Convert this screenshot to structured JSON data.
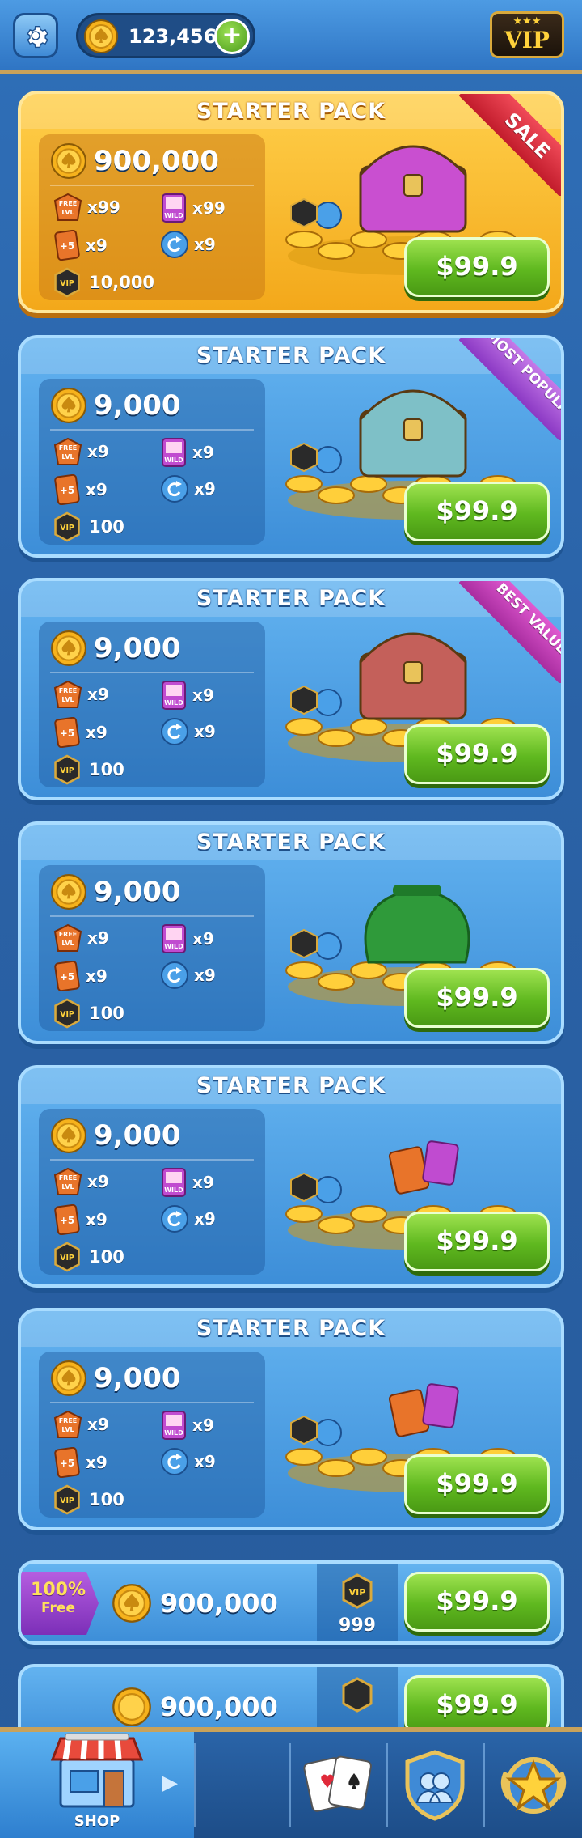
{
  "header": {
    "coin_balance": "123,456",
    "vip_label": "VIP"
  },
  "packs": [
    {
      "title": "STARTER PACK",
      "amount": "900,000",
      "free_lvl": "x99",
      "wild": "x99",
      "plus5": "x9",
      "undo": "x9",
      "vip_points": "10,000",
      "price": "$99.9",
      "ribbon": "SALE"
    },
    {
      "title": "STARTER PACK",
      "amount": "9,000",
      "free_lvl": "x9",
      "wild": "x9",
      "plus5": "x9",
      "undo": "x9",
      "vip_points": "100",
      "price": "$99.9",
      "ribbon": "MOST POPULAR"
    },
    {
      "title": "STARTER PACK",
      "amount": "9,000",
      "free_lvl": "x9",
      "wild": "x9",
      "plus5": "x9",
      "undo": "x9",
      "vip_points": "100",
      "price": "$99.9",
      "ribbon": "BEST VALUE"
    },
    {
      "title": "STARTER PACK",
      "amount": "9,000",
      "free_lvl": "x9",
      "wild": "x9",
      "plus5": "x9",
      "undo": "x9",
      "vip_points": "100",
      "price": "$99.9"
    },
    {
      "title": "STARTER PACK",
      "amount": "9,000",
      "free_lvl": "x9",
      "wild": "x9",
      "plus5": "x9",
      "undo": "x9",
      "vip_points": "100",
      "price": "$99.9"
    },
    {
      "title": "STARTER PACK",
      "amount": "9,000",
      "free_lvl": "x9",
      "wild": "x9",
      "plus5": "x9",
      "undo": "x9",
      "vip_points": "100",
      "price": "$99.9"
    }
  ],
  "coin_offers": [
    {
      "bonus_pct": "100%",
      "bonus_label": "Free",
      "amount": "900,000",
      "vip_points": "999",
      "price": "$99.9"
    },
    {
      "amount": "900,000",
      "price": "$99.9"
    }
  ],
  "icons": {
    "free_level": "FREE LVL",
    "wild": "WILD",
    "plus5": "+5",
    "vip": "VIP"
  },
  "nav": {
    "shop_label": "SHOP"
  }
}
